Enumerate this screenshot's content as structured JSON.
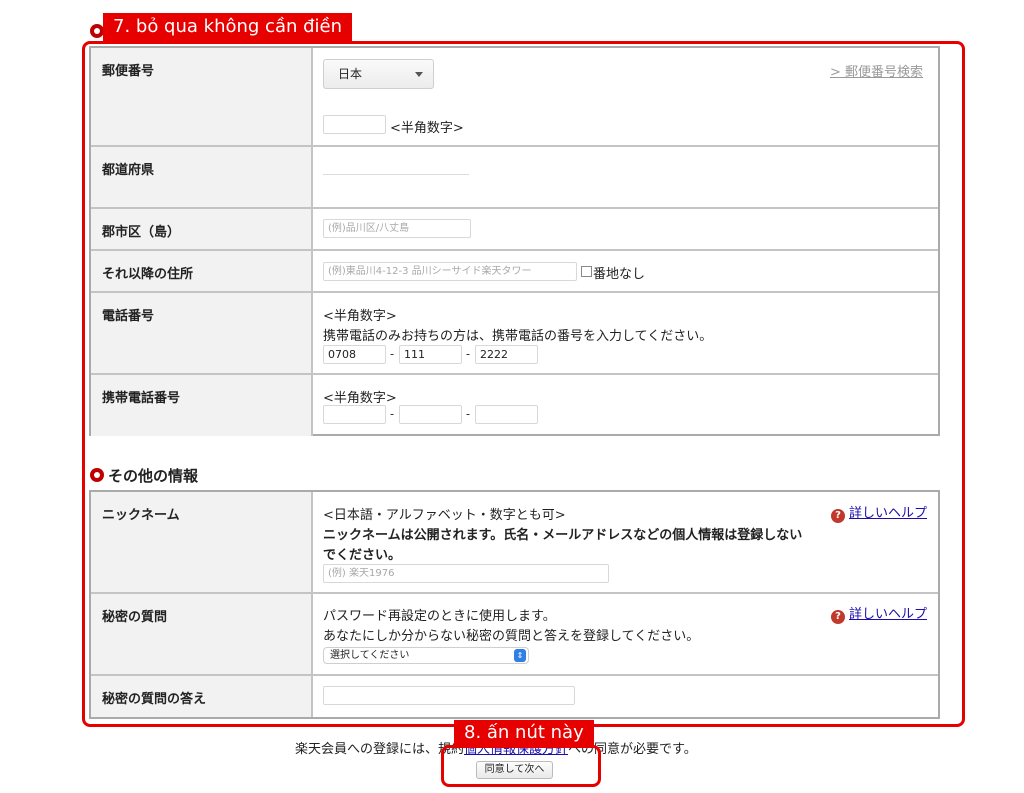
{
  "annotations": {
    "tag7": "7. bỏ qua không cần điền",
    "tag8": "8. ấn nút này"
  },
  "address": {
    "postal": {
      "label": "郵便番号",
      "country": "日本",
      "search_link": "> 郵便番号検索",
      "hint": "<半角数字>"
    },
    "prefecture": {
      "label": "都道府県"
    },
    "city": {
      "label": "郡市区（島）",
      "placeholder": "(例)品川区/八丈島"
    },
    "street": {
      "label": "それ以降の住所",
      "placeholder": "(例)東品川4-12-3 品川シーサイド楽天タワー",
      "no_number_label": "番地なし"
    },
    "phone": {
      "label": "電話番号",
      "hint": "<半角数字>",
      "note": "携帯電話のみお持ちの方は、携帯電話の番号を入力してください。",
      "part1": "0708",
      "part2": "111",
      "part3": "2222",
      "sep": "-"
    },
    "mobile": {
      "label": "携帯電話番号",
      "hint": "<半角数字>",
      "sep": "-"
    }
  },
  "other": {
    "section_title": "その他の情報",
    "nickname": {
      "label": "ニックネーム",
      "hint": "<日本語・アルファベット・数字とも可>",
      "warning_line1": "ニックネームは公開されます。氏名・メールアドレスなどの個人情報は登録しない",
      "warning_line2": "でください。",
      "placeholder": "(例) 楽天1976",
      "help": "詳しいヘルプ"
    },
    "secret_question": {
      "label": "秘密の質問",
      "line1": "パスワード再設定のときに使用します。",
      "line2": "あなたにしか分からない秘密の質問と答えを登録してください。",
      "select_value": "選択してください",
      "help": "詳しいヘルプ"
    },
    "secret_answer": {
      "label": "秘密の質問の答え"
    }
  },
  "footer": {
    "consent_pre": "楽天会員への登録には、規約",
    "consent_link": "個人情報保護方針",
    "consent_post": "への同意が必要です。",
    "agree_button": "同意して次へ"
  },
  "colors": {
    "annotation_red": "#e60000",
    "bullet_red": "#bf0000",
    "help_icon": "#c0392b",
    "label_bg": "#f2f2f2",
    "link": "#1a0dab"
  }
}
